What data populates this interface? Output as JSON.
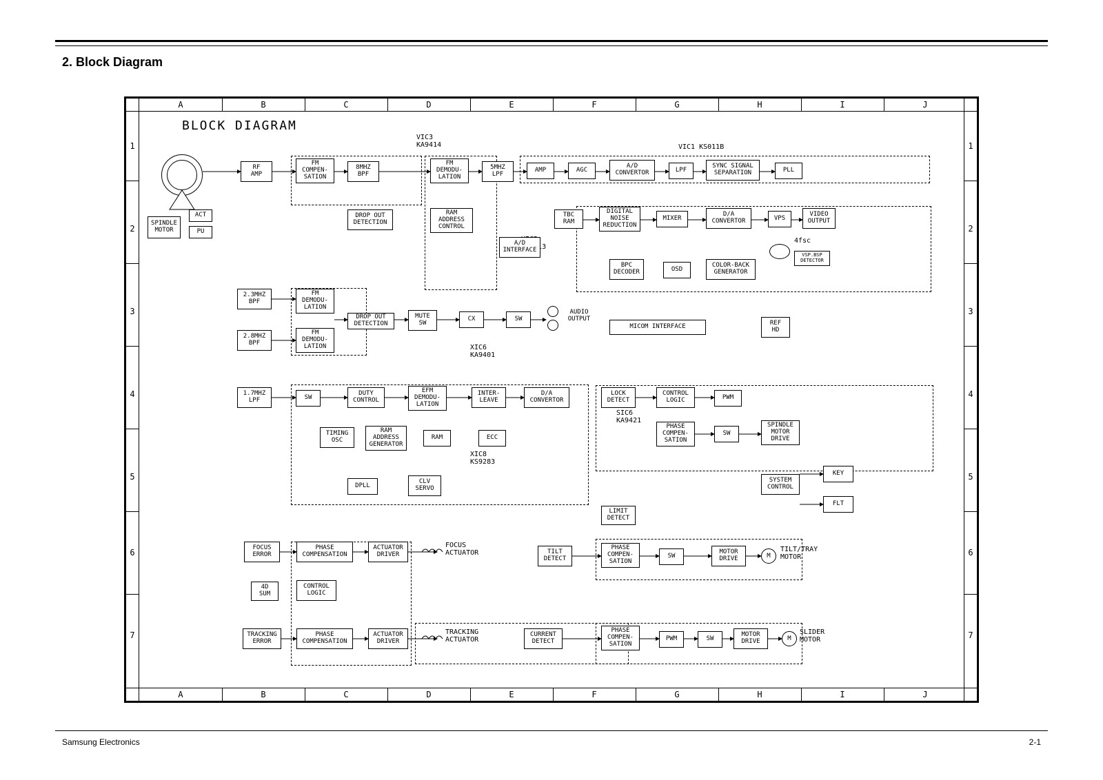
{
  "section_title": "2. Block Diagram",
  "footer_left": "Samsung Electronics",
  "footer_right": "2-1",
  "diagram_title": "BLOCK DIAGRAM",
  "grid_cols": [
    "A",
    "B",
    "C",
    "D",
    "E",
    "F",
    "G",
    "H",
    "I",
    "J"
  ],
  "grid_rows": [
    "1",
    "2",
    "3",
    "4",
    "5",
    "6",
    "7"
  ],
  "chips": {
    "vic3": "VIC3\nKA9414",
    "vic1": "VIC1  KS011B",
    "vic2": "VIC2\nKA9413",
    "xic6": "XIC6\nKA9401",
    "xic8": "XIC8\nKS9283",
    "sic6": "SIC6\nKA9421"
  },
  "blocks": {
    "spindle_motor": "SPINDLE\nMOTOR",
    "act": "ACT",
    "pu": "PU",
    "rf_amp": "RF\nAMP",
    "fm_compen": "FM\nCOMPEN-\nSATION",
    "bpf_8m": "8MHZ\nBPF",
    "fm_demod_top": "FM\nDEMODU-\nLATION",
    "lpf_5m": "5MHZ\nLPF",
    "amp": "AMP",
    "agc": "AGC",
    "ad_conv": "A/D\nCONVERTOR",
    "lpf": "LPF",
    "sync_sep": "SYNC SIGNAL\nSEPARATION",
    "pll": "PLL",
    "dropout1": "DROP OUT\nDETECTION",
    "ram_addr_ctrl": "RAM\nADDRESS\nCONTROL",
    "ad_iface": "A/D\nINTERFACE",
    "tbc_ram": "TBC\nRAM",
    "dig_noise": "DIGITAL\nNOISE\nREDUCTION",
    "mixer": "MIXER",
    "da_conv": "D/A\nCONVERTOR",
    "vps": "VPS",
    "video_out": "VIDEO\nOUTPUT",
    "four_fsc": "4fsc",
    "bpc_dec": "BPC\nDECODER",
    "osd": "OSD",
    "cb_gen": "COLOR-BACK\nGENERATOR",
    "vsp_det": "VSP.BSP\nDETECTOR",
    "bpf_23": "2.3MHZ\nBPF",
    "bpf_28": "2.8MHZ\nBPF",
    "fm_demod_b1": "FM\nDEMODU-\nLATION",
    "fm_demod_b2": "FM\nDEMODU-\nLATION",
    "dropout2": "DROP OUT\nDETECTION",
    "mute_sw": "MUTE\nSW",
    "cx": "CX",
    "sw_mid": "SW",
    "audio_out": "AUDIO\nOUTPUT",
    "micom_if": "MICOM INTERFACE",
    "ref_hd": "REF\nHD",
    "lpf_17": "1.7MHZ\nLPF",
    "sw_dig": "SW",
    "duty_ctrl": "DUTY\nCONTROL",
    "efm_demod": "EFM\nDEMODU-\nLATION",
    "interleave": "INTER-\nLEAVE",
    "da_conv2": "D/A\nCONVERTOR",
    "timing_osc": "TIMING\nOSC",
    "ram_addr_gen": "RAM\nADDRESS\nGENERATOR",
    "ram": "RAM",
    "ecc": "ECC",
    "dpll": "DPLL",
    "clv_servo": "CLV\nSERVO",
    "lock_det": "LOCK\nDETECT",
    "ctrl_logic_r": "CONTROL\nLOGIC",
    "pwm_r": "PWM",
    "phase_comp_r": "PHASE\nCOMPEN-\nSATION",
    "sw_r": "SW",
    "sp_motor_drv": "SPINDLE\nMOTOR\nDRIVE",
    "sys_ctrl": "SYSTEM\nCONTROL",
    "key": "KEY",
    "flt": "FLT",
    "limit_det": "LIMIT\nDETECT",
    "focus_err": "FOCUS\nERROR",
    "phase_comp_f": "PHASE\nCOMPENSATION",
    "act_drv_f": "ACTUATOR\nDRIVER",
    "focus_act": "FOCUS\nACTUATOR",
    "4d_sum": "4D\nSUM",
    "ctrl_logic_l": "CONTROL\nLOGIC",
    "tilt_det": "TILT\nDETECT",
    "phase_comp_t": "PHASE\nCOMPEN-\nSATION",
    "sw_t": "SW",
    "motor_drv_t": "MOTOR\nDRIVE",
    "tilt_tray": "TILT/TRAY\nMOTOR",
    "tracking_err": "TRACKING\nERROR",
    "phase_comp_tr": "PHASE\nCOMPENSATION",
    "act_drv_tr": "ACTUATOR\nDRIVER",
    "tracking_act": "TRACKING\nACTUATOR",
    "current_det": "CURRENT\nDETECT",
    "phase_comp_s": "PHASE\nCOMPEN-\nSATION",
    "pwm_s": "PWM",
    "sw_s": "SW",
    "motor_drv_s": "MOTOR\nDRIVE",
    "slider_motor": "SLIDER\nMOTOR"
  }
}
